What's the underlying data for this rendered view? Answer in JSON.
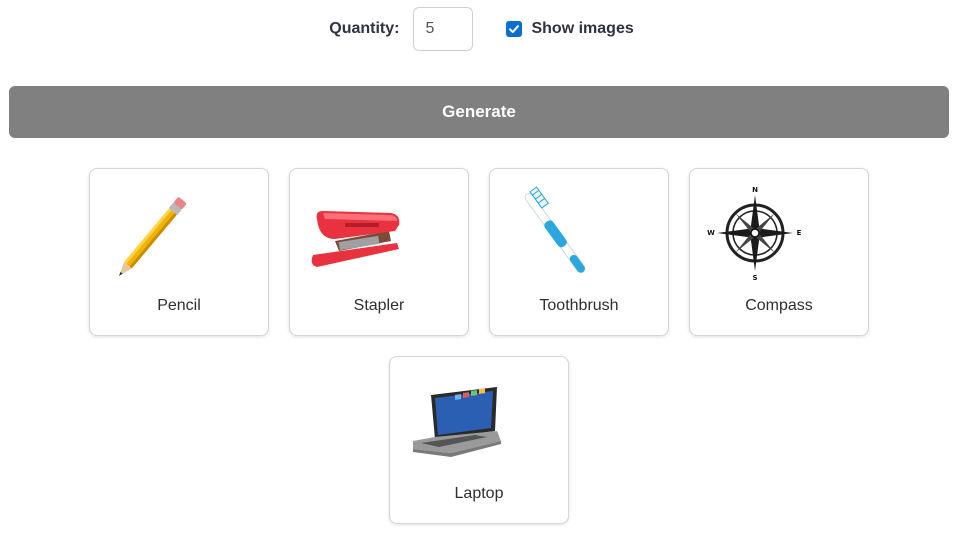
{
  "controls": {
    "quantity_label": "Quantity:",
    "quantity_value": "5",
    "show_images_label": "Show images",
    "show_images_checked": true
  },
  "generate_label": "Generate",
  "colors": {
    "generate_bg": "#808080",
    "checkbox": "#0a6ed1"
  },
  "items": [
    {
      "label": "Pencil",
      "icon": "pencil-icon"
    },
    {
      "label": "Stapler",
      "icon": "stapler-icon"
    },
    {
      "label": "Toothbrush",
      "icon": "toothbrush-icon"
    },
    {
      "label": "Compass",
      "icon": "compass-rose-icon"
    },
    {
      "label": "Laptop",
      "icon": "laptop-icon"
    }
  ],
  "compass_letters": {
    "n": "N",
    "e": "E",
    "s": "S",
    "w": "W"
  }
}
